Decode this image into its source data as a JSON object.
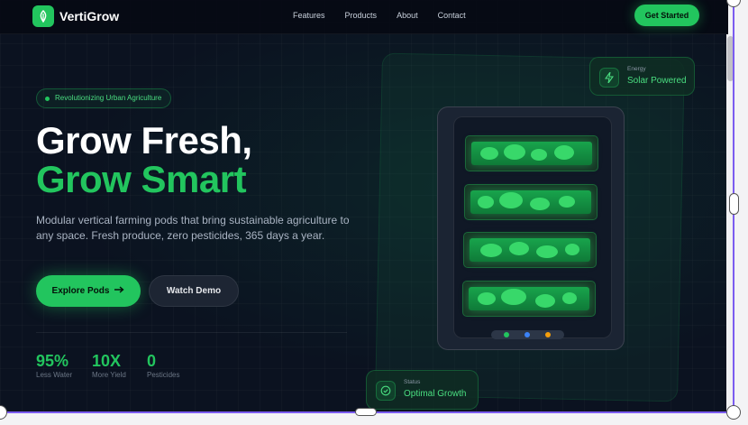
{
  "brand": {
    "name": "VertiGrow",
    "accent": "#22c55e"
  },
  "nav": {
    "links": [
      "Features",
      "Products",
      "About",
      "Contact"
    ],
    "cta": "Get Started"
  },
  "hero": {
    "badge": "Revolutionizing Urban Agriculture",
    "title_line1": "Grow Fresh,",
    "title_line2": "Grow Smart",
    "description": "Modular vertical farming pods that bring sustainable agriculture to any space. Fresh produce, zero pesticides, 365 days a year.",
    "primary_button": "Explore Pods",
    "primary_button_icon": "arrow-right-icon",
    "secondary_button": "Watch Demo"
  },
  "stats": [
    {
      "value": "95%",
      "label": "Less Water"
    },
    {
      "value": "10X",
      "label": "More Yield"
    },
    {
      "value": "0",
      "label": "Pesticides"
    }
  ],
  "cards": {
    "energy": {
      "label": "Energy",
      "value": "Solar Powered",
      "icon": "lightning-icon"
    },
    "status": {
      "label": "Status",
      "value": "Optimal Growth",
      "icon": "check-circle-icon"
    }
  },
  "pod": {
    "trays": 4,
    "indicator_colors": [
      "#22c55e",
      "#3b82f6",
      "#f59e0b"
    ]
  }
}
